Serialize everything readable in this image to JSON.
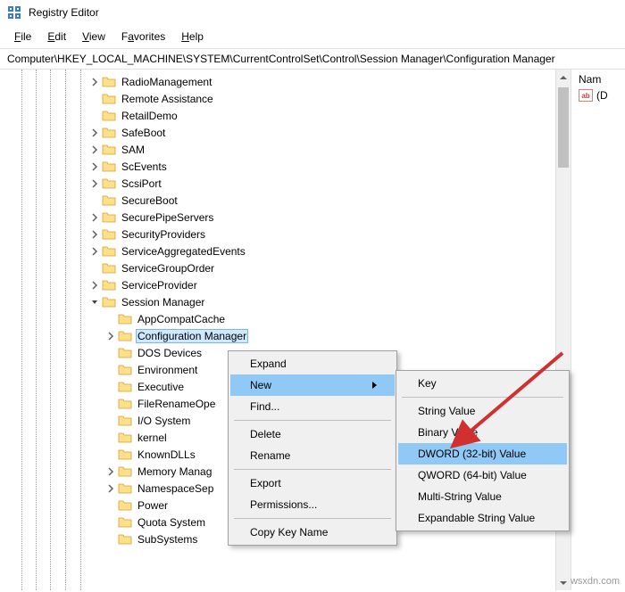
{
  "title": "Registry Editor",
  "menubar": [
    "File",
    "Edit",
    "View",
    "Favorites",
    "Help"
  ],
  "address": "Computer\\HKEY_LOCAL_MACHINE\\SYSTEM\\CurrentControlSet\\Control\\Session Manager\\Configuration Manager",
  "tree_items": [
    {
      "label": "RadioManagement",
      "expander": "right",
      "indent": 5
    },
    {
      "label": "Remote Assistance",
      "expander": "none",
      "indent": 5
    },
    {
      "label": "RetailDemo",
      "expander": "none",
      "indent": 5
    },
    {
      "label": "SafeBoot",
      "expander": "right",
      "indent": 5
    },
    {
      "label": "SAM",
      "expander": "right",
      "indent": 5
    },
    {
      "label": "ScEvents",
      "expander": "right",
      "indent": 5
    },
    {
      "label": "ScsiPort",
      "expander": "right",
      "indent": 5
    },
    {
      "label": "SecureBoot",
      "expander": "none",
      "indent": 5
    },
    {
      "label": "SecurePipeServers",
      "expander": "right",
      "indent": 5
    },
    {
      "label": "SecurityProviders",
      "expander": "right",
      "indent": 5
    },
    {
      "label": "ServiceAggregatedEvents",
      "expander": "right",
      "indent": 5
    },
    {
      "label": "ServiceGroupOrder",
      "expander": "none",
      "indent": 5
    },
    {
      "label": "ServiceProvider",
      "expander": "right",
      "indent": 5
    },
    {
      "label": "Session Manager",
      "expander": "down",
      "indent": 5
    },
    {
      "label": "AppCompatCache",
      "expander": "none",
      "indent": 6
    },
    {
      "label": "Configuration Manager",
      "expander": "right",
      "indent": 6,
      "selected": true
    },
    {
      "label": "DOS Devices",
      "expander": "none",
      "indent": 6
    },
    {
      "label": "Environment",
      "expander": "none",
      "indent": 6
    },
    {
      "label": "Executive",
      "expander": "none",
      "indent": 6
    },
    {
      "label": "FileRenameOpe",
      "expander": "none",
      "indent": 6
    },
    {
      "label": "I/O System",
      "expander": "none",
      "indent": 6
    },
    {
      "label": "kernel",
      "expander": "none",
      "indent": 6
    },
    {
      "label": "KnownDLLs",
      "expander": "none",
      "indent": 6
    },
    {
      "label": "Memory Manag",
      "expander": "right",
      "indent": 6
    },
    {
      "label": "NamespaceSep",
      "expander": "right",
      "indent": 6
    },
    {
      "label": "Power",
      "expander": "none",
      "indent": 6
    },
    {
      "label": "Quota System",
      "expander": "none",
      "indent": 6
    },
    {
      "label": "SubSystems",
      "expander": "none",
      "indent": 6
    }
  ],
  "values_header": "Nam",
  "values_default": "(D",
  "context_primary": {
    "items": [
      {
        "label": "Expand",
        "type": "item"
      },
      {
        "label": "New",
        "type": "item",
        "highlighted": true,
        "arrow": true
      },
      {
        "label": "Find...",
        "type": "item"
      },
      {
        "type": "sep"
      },
      {
        "label": "Delete",
        "type": "item"
      },
      {
        "label": "Rename",
        "type": "item"
      },
      {
        "type": "sep"
      },
      {
        "label": "Export",
        "type": "item"
      },
      {
        "label": "Permissions...",
        "type": "item"
      },
      {
        "type": "sep"
      },
      {
        "label": "Copy Key Name",
        "type": "item"
      }
    ]
  },
  "context_secondary": {
    "items": [
      {
        "label": "Key",
        "type": "item"
      },
      {
        "type": "sep"
      },
      {
        "label": "String Value",
        "type": "item"
      },
      {
        "label": "Binary Value",
        "type": "item"
      },
      {
        "label": "DWORD (32-bit) Value",
        "type": "item",
        "highlighted": true
      },
      {
        "label": "QWORD (64-bit) Value",
        "type": "item"
      },
      {
        "label": "Multi-String Value",
        "type": "item"
      },
      {
        "label": "Expandable String Value",
        "type": "item"
      }
    ]
  },
  "watermark": "wsxdn.com"
}
